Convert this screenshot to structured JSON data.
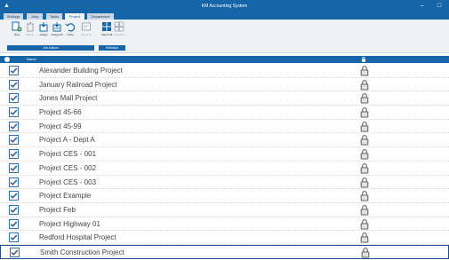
{
  "window": {
    "title": "KM Accounting System",
    "minimize_glyph": "–",
    "maximize_glyph": "□"
  },
  "menu": {
    "tabs": [
      "Settings",
      "Jobs",
      "Tasks",
      "Project",
      "Department"
    ],
    "active_tab": "Project"
  },
  "ribbon": {
    "buttons": [
      {
        "label": "New",
        "icon": "new-project-icon",
        "enabled": true
      },
      {
        "label": "Delete",
        "icon": "delete-icon",
        "enabled": false
      },
      {
        "label": "Assign",
        "icon": "assign-icon",
        "enabled": true
      },
      {
        "label": "Assign All",
        "icon": "assign-all-icon",
        "enabled": true
      },
      {
        "label": "Undo",
        "icon": "undo-icon",
        "enabled": true
      },
      {
        "label": "Edit Job",
        "icon": "edit-job-icon",
        "enabled": false
      },
      {
        "label": "Select All",
        "icon": "select-all-icon",
        "enabled": true
      },
      {
        "label": "Deselect",
        "icon": "deselect-icon",
        "enabled": false
      }
    ],
    "groups": [
      {
        "label": "Job Actions"
      },
      {
        "label": "Selection"
      }
    ]
  },
  "grid": {
    "columns": {
      "name": "Name",
      "lock_icon": "lock-icon"
    },
    "rows": [
      {
        "name": "Alexander Building Project",
        "checked": true,
        "locked": true
      },
      {
        "name": "January Railroad Project",
        "checked": true,
        "locked": true
      },
      {
        "name": "Jones Mall Project",
        "checked": true,
        "locked": true
      },
      {
        "name": "Project 45-66",
        "checked": true,
        "locked": true
      },
      {
        "name": "Project 45-99",
        "checked": true,
        "locked": true
      },
      {
        "name": "Project A - Dept A",
        "checked": true,
        "locked": true
      },
      {
        "name": "Project CES - 001",
        "checked": true,
        "locked": true
      },
      {
        "name": "Project CES - 002",
        "checked": true,
        "locked": true
      },
      {
        "name": "Project CES - 003",
        "checked": true,
        "locked": true
      },
      {
        "name": "Project Example",
        "checked": true,
        "locked": true
      },
      {
        "name": "Project Feb",
        "checked": true,
        "locked": true
      },
      {
        "name": "Project Highway 01",
        "checked": true,
        "locked": true
      },
      {
        "name": "Redford Hospital Project",
        "checked": true,
        "locked": true
      },
      {
        "name": "Smith Construction Project",
        "checked": true,
        "locked": true,
        "selected": true
      }
    ]
  },
  "colors": {
    "accent": "#1565a8",
    "ribbon_bg": "#eef2f6",
    "text": "#444444"
  }
}
